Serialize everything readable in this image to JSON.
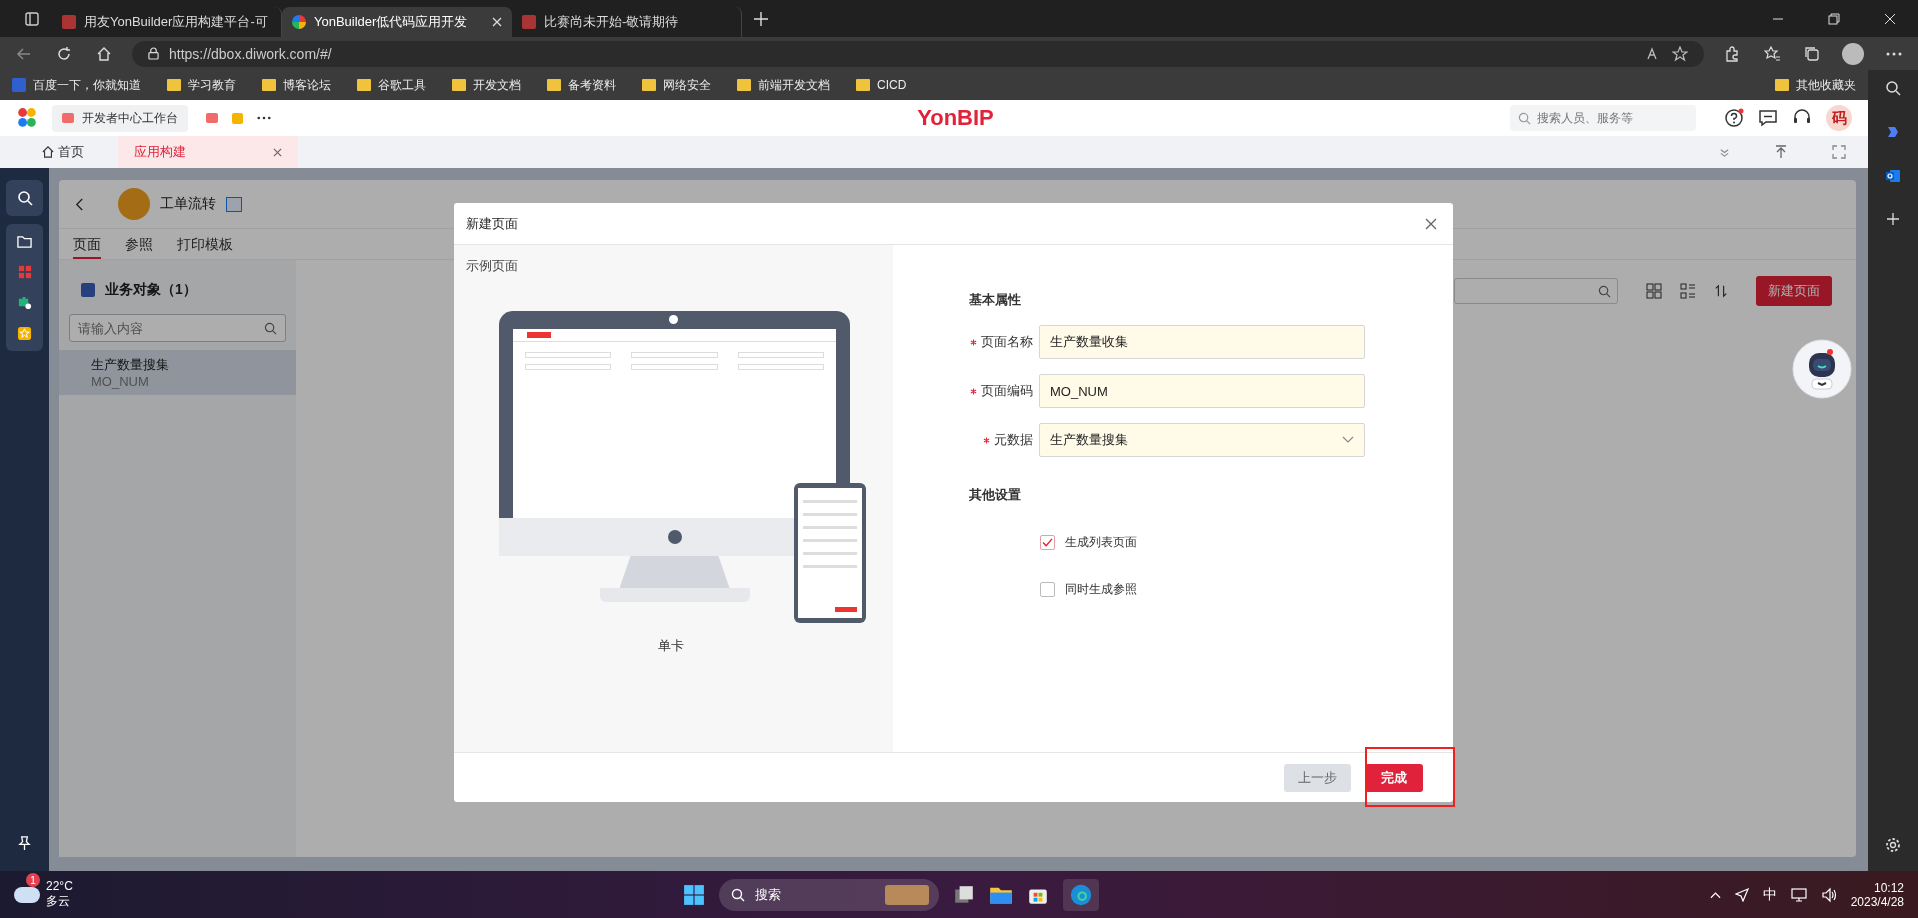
{
  "browser": {
    "tabs": [
      {
        "title": "用友YonBuilder应用构建平台-可",
        "selected": false
      },
      {
        "title": "YonBuilder低代码应用开发",
        "selected": true
      },
      {
        "title": "比赛尚未开始-敬请期待",
        "selected": false
      }
    ],
    "url": "https://dbox.diwork.com/#/",
    "bookmarks": [
      "百度一下，你就知道",
      "学习教育",
      "博客论坛",
      "谷歌工具",
      "开发文档",
      "备考资料",
      "网络安全",
      "前端开发文档",
      "CICD"
    ],
    "other_bookmarks": "其他收藏夹"
  },
  "app_header": {
    "workspace": "开发者中心工作台",
    "logo": "YonBIP",
    "search": {
      "placeholder": "搜索人员、服务等"
    },
    "avatar": "码"
  },
  "app_tabs": [
    {
      "label": "首页",
      "selected": false
    },
    {
      "label": "应用构建",
      "selected": true
    }
  ],
  "app": {
    "title": "工单流转",
    "subtabs": [
      {
        "label": "页面",
        "selected": true
      },
      {
        "label": "参照",
        "selected": false
      },
      {
        "label": "打印模板",
        "selected": false
      }
    ],
    "object_header": "业务对象（1）",
    "search": {
      "placeholder": "请输入内容"
    },
    "items": [
      {
        "name": "生产数量搜集",
        "code": "MO_NUM",
        "selected": true
      }
    ],
    "new_page_button": "新建页面"
  },
  "dialog": {
    "title": "新建页面",
    "preview_label": "示例页面",
    "preview_caption": "单卡",
    "basic_section": "基本属性",
    "fields": [
      {
        "label": "页面名称",
        "required": true,
        "kind": "text",
        "value": "生产数量收集"
      },
      {
        "label": "页面编码",
        "required": true,
        "kind": "text",
        "value": "MO_NUM"
      },
      {
        "label": "元数据",
        "required": true,
        "kind": "select",
        "value": "生产数量搜集"
      }
    ],
    "other_section": "其他设置",
    "options": [
      {
        "label": "生成列表页面",
        "checked": true
      },
      {
        "label": "同时生成参照",
        "checked": false
      }
    ],
    "buttons": [
      {
        "label": "上一步",
        "kind": "secondary"
      },
      {
        "label": "完成",
        "kind": "primary"
      }
    ]
  },
  "taskbar": {
    "weather": {
      "badge": "1",
      "temp": "22°C",
      "condition": "多云"
    },
    "search": "搜索",
    "ime": "中",
    "time": "10:12",
    "date": "2023/4/28"
  }
}
